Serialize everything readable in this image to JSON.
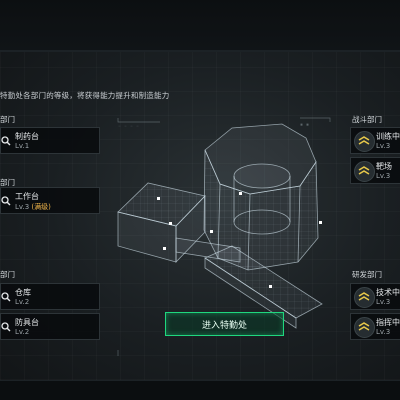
{
  "hint": "特勤处各部门的等级，将获得能力提升和制造能力",
  "left_departments": [
    {
      "label": "部门"
    },
    {
      "label": "部门"
    },
    {
      "label": "部门"
    }
  ],
  "right_departments": [
    {
      "label": "战斗部门"
    },
    {
      "label": "研发部门"
    }
  ],
  "left_cards": [
    {
      "name": "制药台",
      "level": "Lv.1",
      "max_label": ""
    },
    {
      "name": "工作台",
      "level": "Lv.3",
      "max_label": "(满级)"
    },
    {
      "name": "仓库",
      "level": "Lv.2",
      "max_label": ""
    },
    {
      "name": "防具台",
      "level": "Lv.2",
      "max_label": ""
    }
  ],
  "right_cards": [
    {
      "name": "训练中",
      "level": "Lv.3"
    },
    {
      "name": "靶场",
      "level": "Lv.3"
    },
    {
      "name": "技术中",
      "level": "Lv.3"
    },
    {
      "name": "指挥中",
      "level": "Lv.3"
    }
  ],
  "cta": {
    "label": "进入特勤处"
  },
  "icons": {
    "search": "magnifier-icon",
    "rank": "chevron-rank-icon"
  },
  "colors": {
    "accent_green": "#1fd77e",
    "rank_yellow": "#e8c94a",
    "max_orange": "#f0b54a",
    "wireframe": "#cfe0ea"
  }
}
